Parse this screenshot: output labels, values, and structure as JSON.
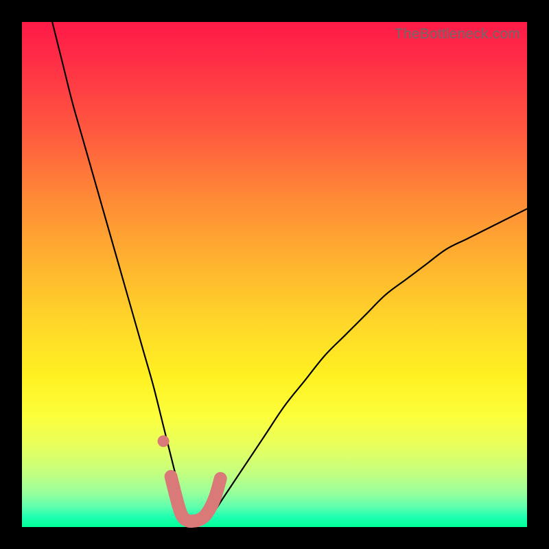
{
  "watermark": "TheBottleneck.com",
  "colors": {
    "frame": "#000000",
    "curve": "#000000",
    "marker_fill": "#d97a78",
    "marker_stroke": "#d97a78"
  },
  "chart_data": {
    "type": "line",
    "title": "",
    "xlabel": "",
    "ylabel": "",
    "xlim": [
      0,
      100
    ],
    "ylim": [
      0,
      100
    ],
    "grid": false,
    "legend": false,
    "series": [
      {
        "name": "bottleneck-curve",
        "x": [
          6,
          8,
          10,
          12,
          14,
          16,
          18,
          20,
          22,
          24,
          26,
          28,
          30,
          31,
          32,
          33,
          34,
          36,
          38,
          40,
          44,
          48,
          52,
          56,
          60,
          64,
          68,
          72,
          76,
          80,
          84,
          88,
          92,
          96,
          100
        ],
        "y": [
          100,
          92,
          84,
          77,
          70,
          63,
          56,
          49,
          42,
          35,
          28,
          20,
          12,
          8,
          4,
          2,
          1,
          1,
          3,
          6,
          12,
          18,
          24,
          29,
          34,
          38,
          42,
          46,
          49,
          52,
          55,
          57,
          59,
          61,
          63
        ]
      }
    ],
    "markers": [
      {
        "name": "salmon-dot",
        "shape": "circle",
        "x": 28.0,
        "y": 17.0
      },
      {
        "name": "salmon-worm",
        "shape": "path",
        "points_x": [
          29.5,
          30.5,
          31.3,
          32.0,
          33.0,
          34.0,
          35.0,
          36.2,
          37.4,
          38.4,
          39.3
        ],
        "points_y": [
          10.0,
          6.0,
          3.2,
          1.8,
          1.2,
          1.2,
          1.4,
          2.2,
          4.0,
          6.4,
          9.6
        ]
      }
    ],
    "background_gradient": {
      "direction": "vertical",
      "stops": [
        {
          "pos": 0.0,
          "color": "#ff1a47"
        },
        {
          "pos": 0.35,
          "color": "#ff8a36"
        },
        {
          "pos": 0.7,
          "color": "#fff022"
        },
        {
          "pos": 0.93,
          "color": "#9cff9a"
        },
        {
          "pos": 1.0,
          "color": "#00ff99"
        }
      ]
    }
  }
}
